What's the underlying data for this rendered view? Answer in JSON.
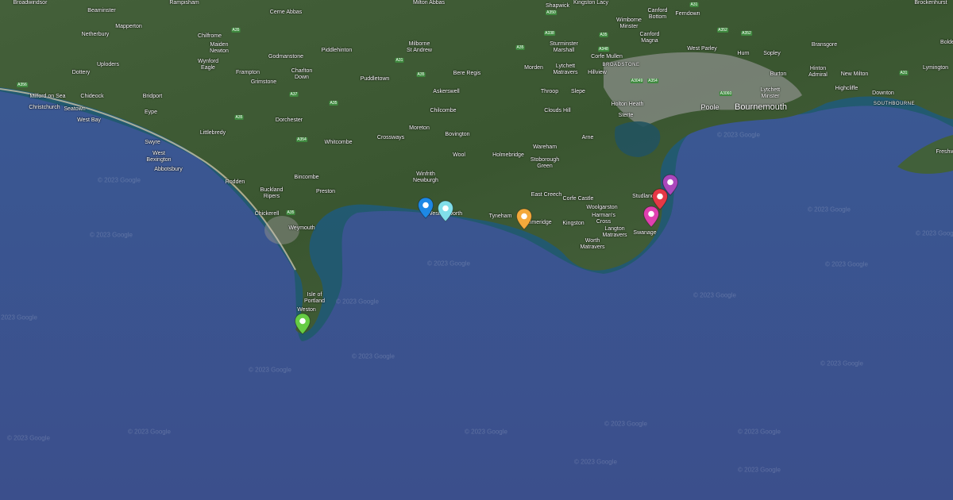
{
  "map": {
    "colors": {
      "sea": "#3b548f",
      "land": "#3d5a2c",
      "shallow": "#1e5a66",
      "urban": "#8c8f8a"
    },
    "places": [
      {
        "name": "Broadwindsor",
        "size": "small"
      },
      {
        "name": "Beaminster",
        "size": "small"
      },
      {
        "name": "Rampisham",
        "size": "small"
      },
      {
        "name": "Cerne Abbas",
        "size": "small"
      },
      {
        "name": "Milton Abbas",
        "size": "small"
      },
      {
        "name": "Shapwick",
        "size": "small"
      },
      {
        "name": "Kingston Lacy",
        "size": "small"
      },
      {
        "name": "Wimborne\nMinster",
        "size": "small"
      },
      {
        "name": "Canford\nBottom",
        "size": "small"
      },
      {
        "name": "Ferndown",
        "size": "small"
      },
      {
        "name": "Netherbury",
        "size": "small"
      },
      {
        "name": "Mapperton",
        "size": "small"
      },
      {
        "name": "Chilfrome",
        "size": "small"
      },
      {
        "name": "Maiden\nNewton",
        "size": "small"
      },
      {
        "name": "Wynford\nEagle",
        "size": "small"
      },
      {
        "name": "Godmanstone",
        "size": "small"
      },
      {
        "name": "Piddlehinton",
        "size": "small"
      },
      {
        "name": "Milborne\nSt Andrew",
        "size": "small"
      },
      {
        "name": "Sturminster\nMarshall",
        "size": "small"
      },
      {
        "name": "Canford\nMagna",
        "size": "small"
      },
      {
        "name": "West Parley",
        "size": "small"
      },
      {
        "name": "Hurn",
        "size": "small"
      },
      {
        "name": "Sopley",
        "size": "small"
      },
      {
        "name": "Bransgore",
        "size": "small"
      },
      {
        "name": "Bolde",
        "size": "small"
      },
      {
        "name": "Lymington",
        "size": "small"
      },
      {
        "name": "Brockenhurst",
        "size": "small"
      },
      {
        "name": "Dottery",
        "size": "small"
      },
      {
        "name": "Uploders",
        "size": "small"
      },
      {
        "name": "Frampton",
        "size": "small"
      },
      {
        "name": "Charlton\nDown",
        "size": "small"
      },
      {
        "name": "Grimstone",
        "size": "small"
      },
      {
        "name": "Puddletown",
        "size": "small"
      },
      {
        "name": "Bere Regis",
        "size": "small"
      },
      {
        "name": "Morden",
        "size": "small"
      },
      {
        "name": "Lytchett\nMatravers",
        "size": "small"
      },
      {
        "name": "Corfe Mullen",
        "size": "small"
      },
      {
        "name": "BROADSTONE",
        "size": "district"
      },
      {
        "name": "Hillview",
        "size": "small"
      },
      {
        "name": "Burton",
        "size": "small"
      },
      {
        "name": "Hinton\nAdmiral",
        "size": "small"
      },
      {
        "name": "New Milton",
        "size": "small"
      },
      {
        "name": "Highcliffe",
        "size": "small"
      },
      {
        "name": "Downton",
        "size": "small"
      },
      {
        "name": "Milford on Sea",
        "size": "small"
      },
      {
        "name": "Chideock",
        "size": "small"
      },
      {
        "name": "Bridport",
        "size": "small"
      },
      {
        "name": "Askerswell",
        "size": "small"
      },
      {
        "name": "Throop",
        "size": "small"
      },
      {
        "name": "Slepe",
        "size": "small"
      },
      {
        "name": "Lytchett\nMinster",
        "size": "small"
      },
      {
        "name": "Christchurch",
        "size": "small"
      },
      {
        "name": "Seatown",
        "size": "small"
      },
      {
        "name": "Eype",
        "size": "small"
      },
      {
        "name": "Chilcombe",
        "size": "small"
      },
      {
        "name": "Clouds Hill",
        "size": "small"
      },
      {
        "name": "Holton Heath",
        "size": "small"
      },
      {
        "name": "Sterte",
        "size": "small"
      },
      {
        "name": "Poole",
        "size": "town"
      },
      {
        "name": "Bournemouth",
        "size": "city"
      },
      {
        "name": "SOUTHBOURNE",
        "size": "district"
      },
      {
        "name": "West Bay",
        "size": "small"
      },
      {
        "name": "Dorchester",
        "size": "small"
      },
      {
        "name": "Littlebredy",
        "size": "small"
      },
      {
        "name": "Moreton",
        "size": "small"
      },
      {
        "name": "Bovington",
        "size": "small"
      },
      {
        "name": "Crossways",
        "size": "small"
      },
      {
        "name": "Arne",
        "size": "small"
      },
      {
        "name": "Freshw",
        "size": "small"
      },
      {
        "name": "Swyre",
        "size": "small"
      },
      {
        "name": "West\nBexington",
        "size": "small"
      },
      {
        "name": "Whitcombe",
        "size": "small"
      },
      {
        "name": "Wool",
        "size": "small"
      },
      {
        "name": "Holmebridge",
        "size": "small"
      },
      {
        "name": "Wareham",
        "size": "small"
      },
      {
        "name": "Stoborough\nGreen",
        "size": "small"
      },
      {
        "name": "Abbotsbury",
        "size": "small"
      },
      {
        "name": "Winfrith\nNewburgh",
        "size": "small"
      },
      {
        "name": "Bincombe",
        "size": "small"
      },
      {
        "name": "Rodden",
        "size": "small"
      },
      {
        "name": "Buckland\nRipers",
        "size": "small"
      },
      {
        "name": "Preston",
        "size": "small"
      },
      {
        "name": "East Creech",
        "size": "small"
      },
      {
        "name": "Corfe Castle",
        "size": "small"
      },
      {
        "name": "Studland",
        "size": "small"
      },
      {
        "name": "Woolgarston",
        "size": "small"
      },
      {
        "name": "Harman's\nCross",
        "size": "small"
      },
      {
        "name": "Chickerell",
        "size": "small"
      },
      {
        "name": "West Lulworth",
        "size": "small"
      },
      {
        "name": "Tyneham",
        "size": "small"
      },
      {
        "name": "Kimmeridge",
        "size": "small"
      },
      {
        "name": "Kingston",
        "size": "small"
      },
      {
        "name": "Langton\nMatravers",
        "size": "small"
      },
      {
        "name": "Swanage",
        "size": "small"
      },
      {
        "name": "Weymouth",
        "size": "small"
      },
      {
        "name": "Worth\nMatravers",
        "size": "small"
      },
      {
        "name": "Isle of\nPortland",
        "size": "small"
      },
      {
        "name": "Weston",
        "size": "small"
      }
    ],
    "roads": [
      "A356",
      "A350",
      "A31",
      "A35",
      "A37",
      "A354",
      "A35",
      "A31",
      "A338",
      "A348",
      "A35",
      "A35",
      "A3049",
      "A352",
      "A35",
      "A354",
      "A352",
      "A35",
      "A35",
      "A3060",
      "A31"
    ],
    "watermark": "© 2023 Google",
    "markers": [
      {
        "color": "#1e88e5",
        "name": "marker-blue"
      },
      {
        "color": "#80deea",
        "name": "marker-light-blue"
      },
      {
        "color": "#f4a93b",
        "name": "marker-orange"
      },
      {
        "color": "#ab47bc",
        "name": "marker-purple"
      },
      {
        "color": "#e53946",
        "name": "marker-red"
      },
      {
        "color": "#e040b0",
        "name": "marker-pink"
      },
      {
        "color": "#66cc44",
        "name": "marker-green"
      }
    ]
  }
}
